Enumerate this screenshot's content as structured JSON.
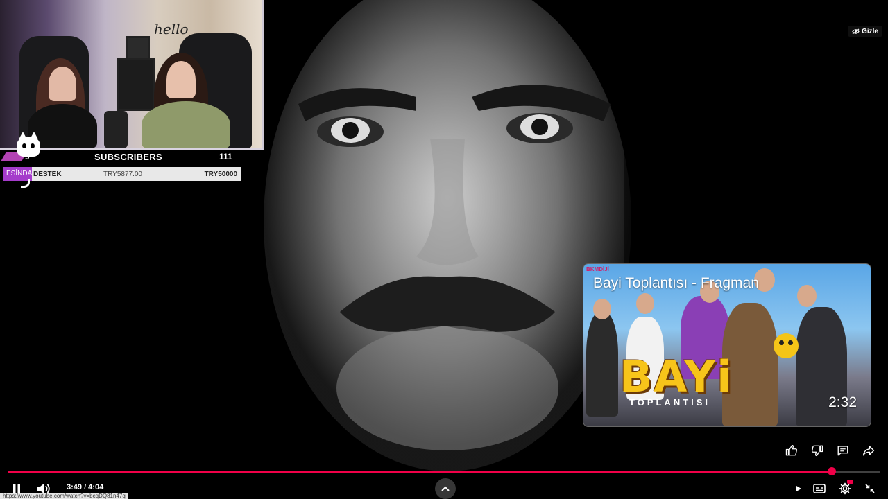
{
  "webcam": {
    "hello_text": "hello",
    "subscriber_bar": {
      "left_value": "9",
      "title": "SUBSCRIBERS",
      "right_value": "111"
    },
    "donation_bar": {
      "tag": "ESİNDA",
      "label": "DESTEK",
      "amount": "TRY5877.00",
      "goal": "TRY50000"
    }
  },
  "hide_button": {
    "label": "Gizle",
    "icon": "eye-off-icon"
  },
  "end_card": {
    "channel_label": "BKMDİJİ",
    "title": "Bayi Toplantısı - Fragman",
    "logo_main": "BAYi",
    "logo_sub": "TOPLANTISI",
    "duration": "2:32"
  },
  "actions": {
    "like": "thumbs-up-icon",
    "dislike": "thumbs-down-icon",
    "comments": "comment-icon",
    "share": "share-icon"
  },
  "player": {
    "progress_fraction": 0.945,
    "time_display": "3:49 / 4:04",
    "accent_color": "#f00048"
  },
  "status_bar": {
    "url": "https://www.youtube.com/watch?v=bcqDQ81n47q"
  }
}
